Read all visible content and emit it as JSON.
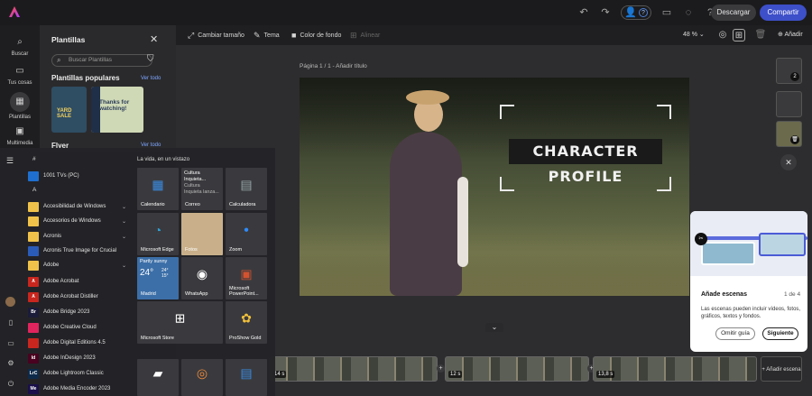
{
  "topbar": {
    "collab_count": "?",
    "download_label": "Descargar",
    "share_label": "Compartir",
    "colors": {
      "share": "#3d4fc9"
    }
  },
  "rail": {
    "items": [
      {
        "label": "Buscar",
        "icon": "search-icon"
      },
      {
        "label": "Tus cosas",
        "icon": "folder-icon"
      },
      {
        "label": "Plantillas",
        "icon": "templates-icon"
      },
      {
        "label": "Multimedia",
        "icon": "media-icon"
      }
    ]
  },
  "templates_panel": {
    "title": "Plantillas",
    "search_placeholder": "Buscar Plantillas",
    "popular_title": "Plantillas populares",
    "see_all": "Ver todo",
    "thumb1_text": "YARD SALE",
    "thumb2_text": "Thanks for watching!",
    "flyer_title": "Flyer",
    "flyer_see_all": "Ver todo"
  },
  "toolbar": {
    "resize": "Cambiar tamaño",
    "theme": "Tema",
    "background_color": "Color de fondo",
    "align": "Alinear",
    "zoom": "48 %",
    "add": "Añadir"
  },
  "canvas": {
    "page_label": "Página 1 / 1 - Añadir título",
    "headline": "CHARACTER PROFILE"
  },
  "side_thumbs": {
    "badge1": "2"
  },
  "timeline": {
    "scenes": [
      {
        "duration": "14 s"
      },
      {
        "duration": "12 s"
      },
      {
        "duration": "13,8 s"
      }
    ],
    "add_scene": "+ Añadir escena"
  },
  "coach": {
    "title": "Añade escenas",
    "step": "1 de 4",
    "body": "Las escenas pueden incluir vídeos, fotos, gráficos, textos y fondos.",
    "skip": "Omitir guía",
    "next": "Siguiente"
  },
  "start_menu": {
    "letters": [
      "#",
      "A"
    ],
    "apps": [
      {
        "label": "1001 TVs (PC)",
        "color": "#1f6fd0",
        "icon": "tv-icon",
        "caret": ""
      },
      {
        "label": "Accesibilidad de Windows",
        "color": "#f0c24a",
        "icon": "folder-icon",
        "caret": "⌄"
      },
      {
        "label": "Accesorios de Windows",
        "color": "#f0c24a",
        "icon": "folder-icon",
        "caret": "⌄"
      },
      {
        "label": "Acronis",
        "color": "#f0c24a",
        "icon": "folder-icon",
        "caret": "⌄"
      },
      {
        "label": "Acronis True Image for Crucial",
        "color": "#2b5bb8",
        "icon": "acronis-icon",
        "caret": ""
      },
      {
        "label": "Adobe",
        "color": "#f0c24a",
        "icon": "folder-icon",
        "caret": "⌄"
      },
      {
        "label": "Adobe Acrobat",
        "color": "#c8261e",
        "icon": "acrobat-icon",
        "caret": ""
      },
      {
        "label": "Adobe Acrobat Distiller",
        "color": "#c8261e",
        "icon": "acrobat-distiller-icon",
        "caret": ""
      },
      {
        "label": "Adobe Bridge 2023",
        "color": "#1b1b3a",
        "icon": "bridge-icon",
        "caret": ""
      },
      {
        "label": "Adobe Creative Cloud",
        "color": "#e0245e",
        "icon": "creative-cloud-icon",
        "caret": ""
      },
      {
        "label": "Adobe Digital Editions 4.5",
        "color": "#c8261e",
        "icon": "digital-editions-icon",
        "caret": ""
      },
      {
        "label": "Adobe InDesign 2023",
        "color": "#49021f",
        "icon": "indesign-icon",
        "caret": ""
      },
      {
        "label": "Adobe Lightroom Classic",
        "color": "#0d2a4a",
        "icon": "lightroom-icon",
        "caret": ""
      },
      {
        "label": "Adobe Media Encoder 2023",
        "color": "#1a0f4a",
        "icon": "media-encoder-icon",
        "caret": ""
      }
    ],
    "app_icons_text": [
      "",
      "",
      "",
      "",
      "",
      "",
      "A",
      "A",
      "Br",
      "",
      "",
      "Id",
      "LrC",
      "Me"
    ],
    "tiles_title": "La vida, en un vistazo",
    "tiles": {
      "calendar": "Calendario",
      "mail_title": "Cultura Inquieta...",
      "mail_line1": "Cultura",
      "mail_line2": "Inquieta lanza...",
      "mail": "Correo",
      "calculator": "Calculadora",
      "edge": "Microsoft Edge",
      "photos": "Fotos",
      "zoom": "Zoom",
      "weather_cond": "Partly sunny",
      "weather_temp": "24°",
      "weather_temp2": "24°",
      "weather_temp3": "15°",
      "weather_city": "Madrid",
      "whatsapp": "WhatsApp",
      "powerpoint": "Microsoft PowerPoint...",
      "store": "Microsoft Store",
      "proshow": "ProShow Gold"
    }
  }
}
